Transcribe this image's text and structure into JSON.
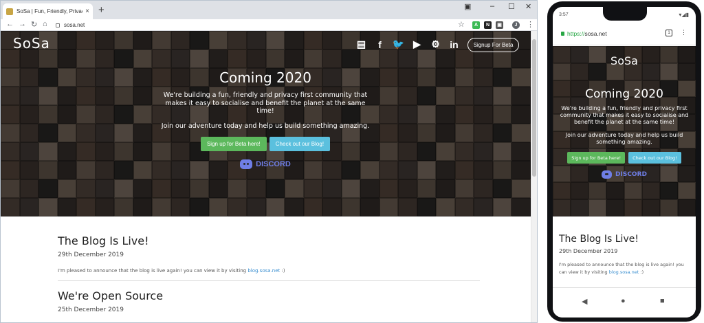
{
  "desktop": {
    "tab_title": "SoSa | Fun, Friendly, Privacy First",
    "tab_close": "×",
    "new_tab": "+",
    "window_controls": {
      "minimize": "–",
      "maximize": "☐",
      "close": "✕"
    },
    "nav": {
      "back": "←",
      "forward": "→",
      "reload": "↻",
      "home": "⌂"
    },
    "url": "sosa.net",
    "star": "☆",
    "extensions": [
      {
        "label": "A",
        "color": "#3cba54"
      },
      {
        "label": "N",
        "color": "#222222"
      },
      {
        "label": "▣",
        "color": "#555555"
      },
      {
        "label": "J",
        "color": "#5f6368"
      }
    ],
    "menu": "⋮"
  },
  "site": {
    "logo": "SoSa",
    "social_icons": [
      {
        "name": "news-icon",
        "glyph": "▤"
      },
      {
        "name": "facebook-icon",
        "glyph": "f"
      },
      {
        "name": "twitter-icon",
        "glyph": "🐦"
      },
      {
        "name": "youtube-icon",
        "glyph": "▶"
      },
      {
        "name": "steam-icon",
        "glyph": "⚙"
      },
      {
        "name": "linkedin-icon",
        "glyph": "in"
      }
    ],
    "signup_button": "Signup For Beta",
    "hero_title": "Coming 2020",
    "hero_text_1": "We're building a fun, friendly and privacy first community that makes it easy to socialise and benefit the planet at the same time!",
    "hero_text_2": "Join our adventure today and help us build something amazing.",
    "beta_button": "Sign up for Beta here!",
    "blog_button": "Check out our Blog!",
    "discord_label": "DISCORD",
    "posts": [
      {
        "title": "The Blog Is Live!",
        "date": "29th December 2019",
        "body": "I'm pleased to announce that the blog is live again! you can view it by visiting",
        "link": "blog.sosa.net",
        "suffix": " :)"
      },
      {
        "title": "We're Open Source",
        "date": "25th December 2019"
      }
    ]
  },
  "phone": {
    "time": "3:57",
    "status_icons": "▾◢▮",
    "url_scheme": "https://",
    "url_host": "sosa.net",
    "tab_count": "1",
    "menu": "⋮",
    "nav_back": "◀",
    "nav_home": "●",
    "nav_recent": "■"
  },
  "colors": {
    "green_button": "#5cb85c",
    "blue_button": "#5bc0de",
    "discord": "#6f7ee6",
    "link": "#3b8fd0"
  }
}
